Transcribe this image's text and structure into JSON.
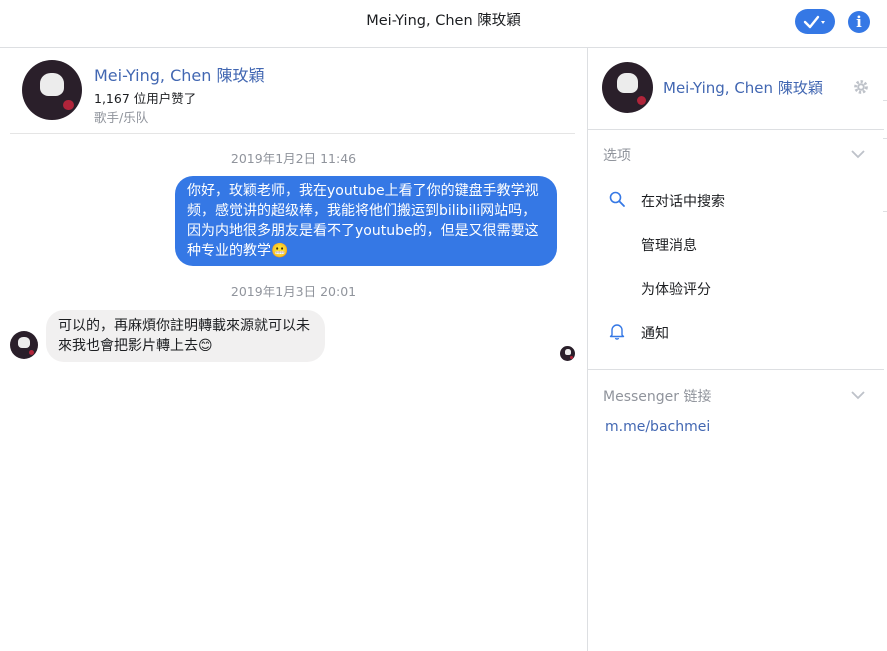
{
  "topbar": {
    "title": "Mei-Ying, Chen 陳玫穎",
    "check_icon": "check-dropdown-icon",
    "info_icon": "info-icon",
    "info_glyph": "i",
    "accent": "#3578e5"
  },
  "profile": {
    "name": "Mei-Ying, Chen 陳玫穎",
    "likes": "1,167 位用户赞了",
    "category": "歌手/乐队"
  },
  "messages": [
    {
      "timestamp": "2019年1月2日 11:46",
      "direction": "outgoing",
      "text": "你好，玫颖老师，我在youtube上看了你的键盘手教学视频，感觉讲的超级棒，我能将他们搬运到bilibili网站吗，因为内地很多朋友是看不了youtube的，但是又很需要这种专业的教学😬"
    },
    {
      "timestamp": "2019年1月3日 20:01",
      "direction": "incoming",
      "text": "可以的，再麻煩你註明轉載來源就可以未來我也會把影片轉上去😊"
    }
  ],
  "sidebar": {
    "name": "Mei-Ying, Chen 陳玫穎",
    "gear_icon": "gear-icon",
    "options_title": "选项",
    "options": [
      {
        "label": "在对话中搜索",
        "icon": "search-icon"
      },
      {
        "label": "管理消息",
        "icon": ""
      },
      {
        "label": "为体验评分",
        "icon": ""
      },
      {
        "label": "通知",
        "icon": "bell-icon"
      }
    ],
    "links_title": "Messenger 链接",
    "link": "m.me/bachmei"
  }
}
